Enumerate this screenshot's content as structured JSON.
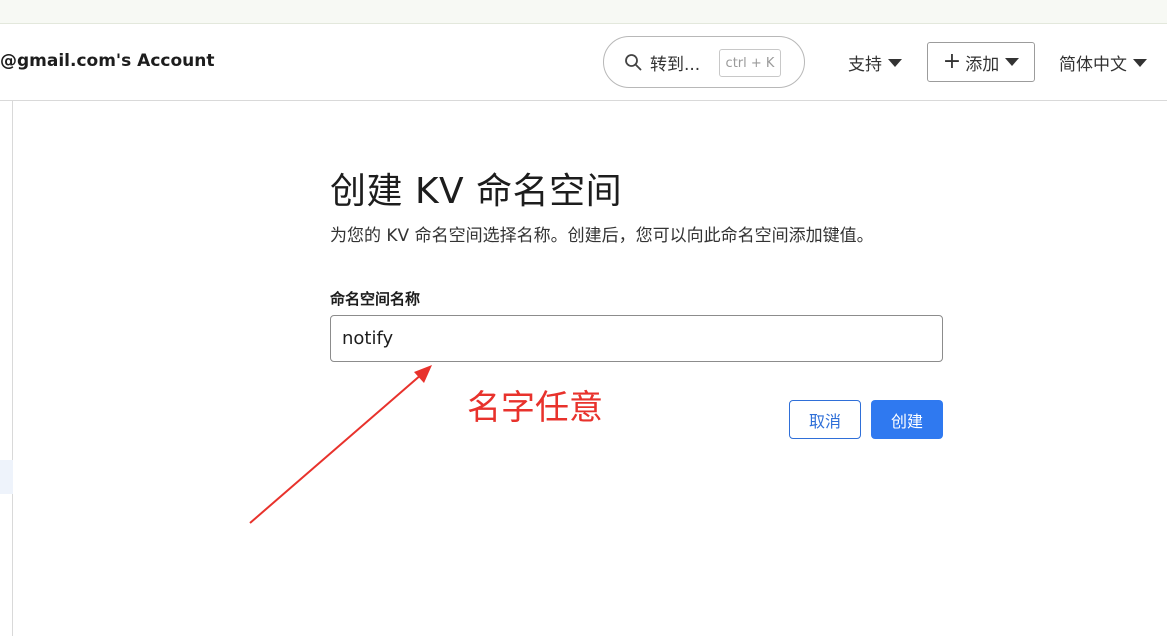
{
  "header": {
    "account_name": "@gmail.com's Account",
    "search_placeholder": "转到...",
    "search_shortcut": "ctrl + K",
    "support_label": "支持",
    "add_label": "添加",
    "language_label": "简体中文"
  },
  "form": {
    "title": "创建 KV 命名空间",
    "description": "为您的 KV 命名空间选择名称。创建后，您可以向此命名空间添加键值。",
    "field_label": "命名空间名称",
    "field_value": "notify",
    "cancel_label": "取消",
    "create_label": "创建"
  },
  "annotation": {
    "text": "名字任意",
    "color": "#e8322c"
  },
  "colors": {
    "primary": "#2f79f0",
    "accent_outline": "#2f6fd8"
  },
  "icons": {
    "search": "search-icon",
    "support_caret": "chevron-down-icon",
    "add_plus": "plus-icon",
    "add_caret": "chevron-down-icon",
    "language_caret": "chevron-down-icon"
  }
}
